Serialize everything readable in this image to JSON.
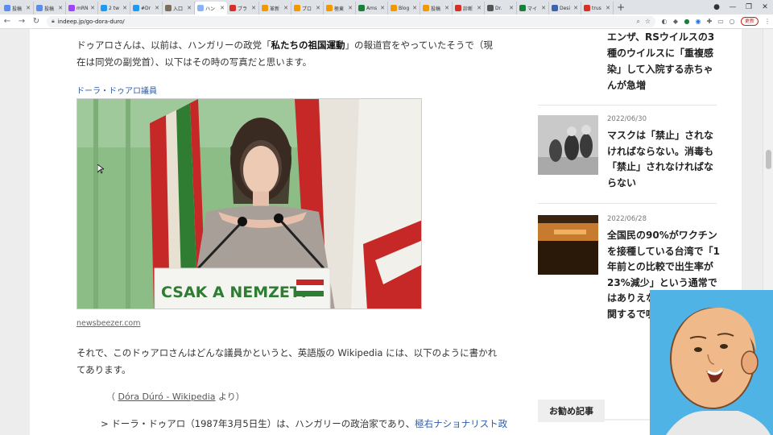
{
  "browser": {
    "tabs": [
      {
        "label": "投稿",
        "color": "#5b8def"
      },
      {
        "label": "投稿",
        "color": "#5b8def"
      },
      {
        "label": "mRN",
        "color": "#a142f4"
      },
      {
        "label": "2 tw",
        "color": "#1d9bf0"
      },
      {
        "label": "#Dr",
        "color": "#1d9bf0"
      },
      {
        "label": "入口",
        "color": "#7a6f5a"
      },
      {
        "label": "ハン",
        "color": "#8ab4f8"
      },
      {
        "label": "ブラ",
        "color": "#d93025"
      },
      {
        "label": "革新",
        "color": "#f29900"
      },
      {
        "label": "プロ",
        "color": "#f29900"
      },
      {
        "label": "極東",
        "color": "#f29900"
      },
      {
        "label": "Ams",
        "color": "#188038"
      },
      {
        "label": "Blog",
        "color": "#f29900"
      },
      {
        "label": "投稿",
        "color": "#f29900"
      },
      {
        "label": "診断",
        "color": "#d93025"
      },
      {
        "label": "Dr.",
        "color": "#555555"
      },
      {
        "label": "マイ",
        "color": "#188038"
      },
      {
        "label": "Desi",
        "color": "#3c64b1"
      },
      {
        "label": "trus",
        "color": "#d93025"
      }
    ],
    "active_tab_index": 6,
    "url": "indeep.jp/go-dora-duro/",
    "update_label": "更新"
  },
  "article": {
    "p1_before": "ドゥアロさんは、以前は、ハンガリーの政党「",
    "p1_bold": "私たちの祖国運動",
    "p1_after": "」の報道官をやっていたそうで（現在は同党の副党首）、以下はその時の写真だと思います。",
    "caption": "ドーラ・ドゥアロ議員",
    "podium_text": "CSAK A NEMZET!",
    "source": "newsbeezer.com",
    "p2": "それで、このドゥアロさんはどんな議員かというと、英語版の Wikipedia には、以下のように書かれてあります。",
    "quote_ref_open": "（ ",
    "quote_ref_link": "Dóra Dúró - Wikipedia",
    "quote_ref_close": " より）",
    "quote_before": "> ドーラ・ドゥアロ（1987年3月5日生）は、ハンガリーの政治家であり、",
    "quote_link": "極右ナショナリスト政"
  },
  "sidebar": {
    "top_title": "エンザ、RSウイルスの3種のウイルスに「重複感染」して入院する赤ちゃんが急増",
    "items": [
      {
        "date": "2022/06/30",
        "title": "マスクは「禁止」されなければならない。消毒も「禁止」されなければならない"
      },
      {
        "date": "2022/06/28",
        "title": "全国民の90%がワクチンを接種している台湾で「1年前との比較で出生率が23%減少」という通常ではありえない報告。妊に関するで噴出してか..."
      }
    ],
    "recommend_label": "お勧め記事"
  },
  "colors": {
    "link": "#2a5db0",
    "webcam_bg": "#4fb3e6",
    "flag_green": "#2e7d32",
    "flag_red": "#c62828"
  }
}
